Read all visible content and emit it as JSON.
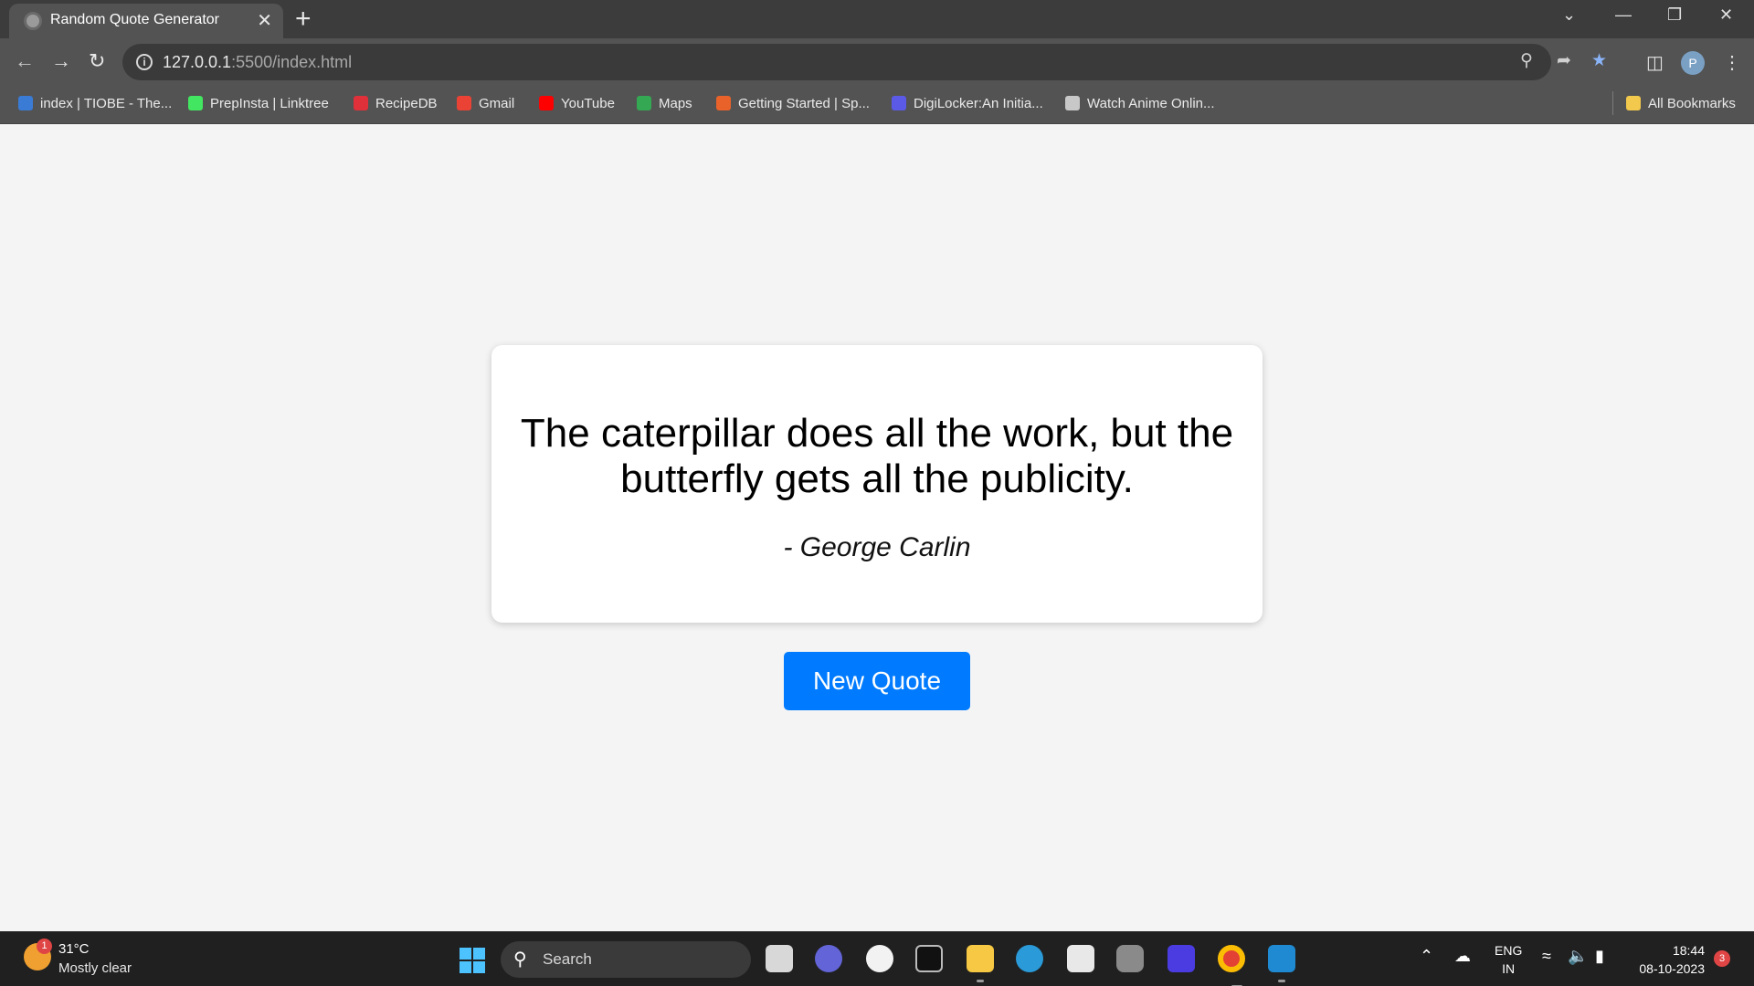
{
  "browser": {
    "tab_title": "Random Quote Generator",
    "tab_close": "✕",
    "new_tab": "+",
    "url_host": "127.0.0.1",
    "url_rest": ":5500/index.html",
    "avatar_letter": "P",
    "bookmarks": [
      {
        "label": "index | TIOBE - The...",
        "color": "#3a7bd5"
      },
      {
        "label": "PrepInsta | Linktree",
        "color": "#43e660"
      },
      {
        "label": "RecipeDB",
        "color": "#e0303a"
      },
      {
        "label": "Gmail",
        "color": "#ea4335"
      },
      {
        "label": "YouTube",
        "color": "#ff0000"
      },
      {
        "label": "Maps",
        "color": "#34a853"
      },
      {
        "label": "Getting Started | Sp...",
        "color": "#e8622a"
      },
      {
        "label": "DigiLocker:An Initia...",
        "color": "#5a5ae6"
      },
      {
        "label": "Watch Anime Onlin...",
        "color": "#c8c8c8"
      }
    ],
    "all_bookmarks": "All Bookmarks"
  },
  "page": {
    "quote": "The caterpillar does all the work, but the butterfly gets all the publicity.",
    "author": "- George Carlin",
    "button_label": "New Quote",
    "button_color": "#007bff"
  },
  "taskbar": {
    "weather_temp": "31°C",
    "weather_condition": "Mostly clear",
    "weather_badge": "1",
    "search_label": "Search",
    "lang_line1": "ENG",
    "lang_line2": "IN",
    "time": "18:44",
    "date": "08-10-2023",
    "notification_count": "3"
  }
}
